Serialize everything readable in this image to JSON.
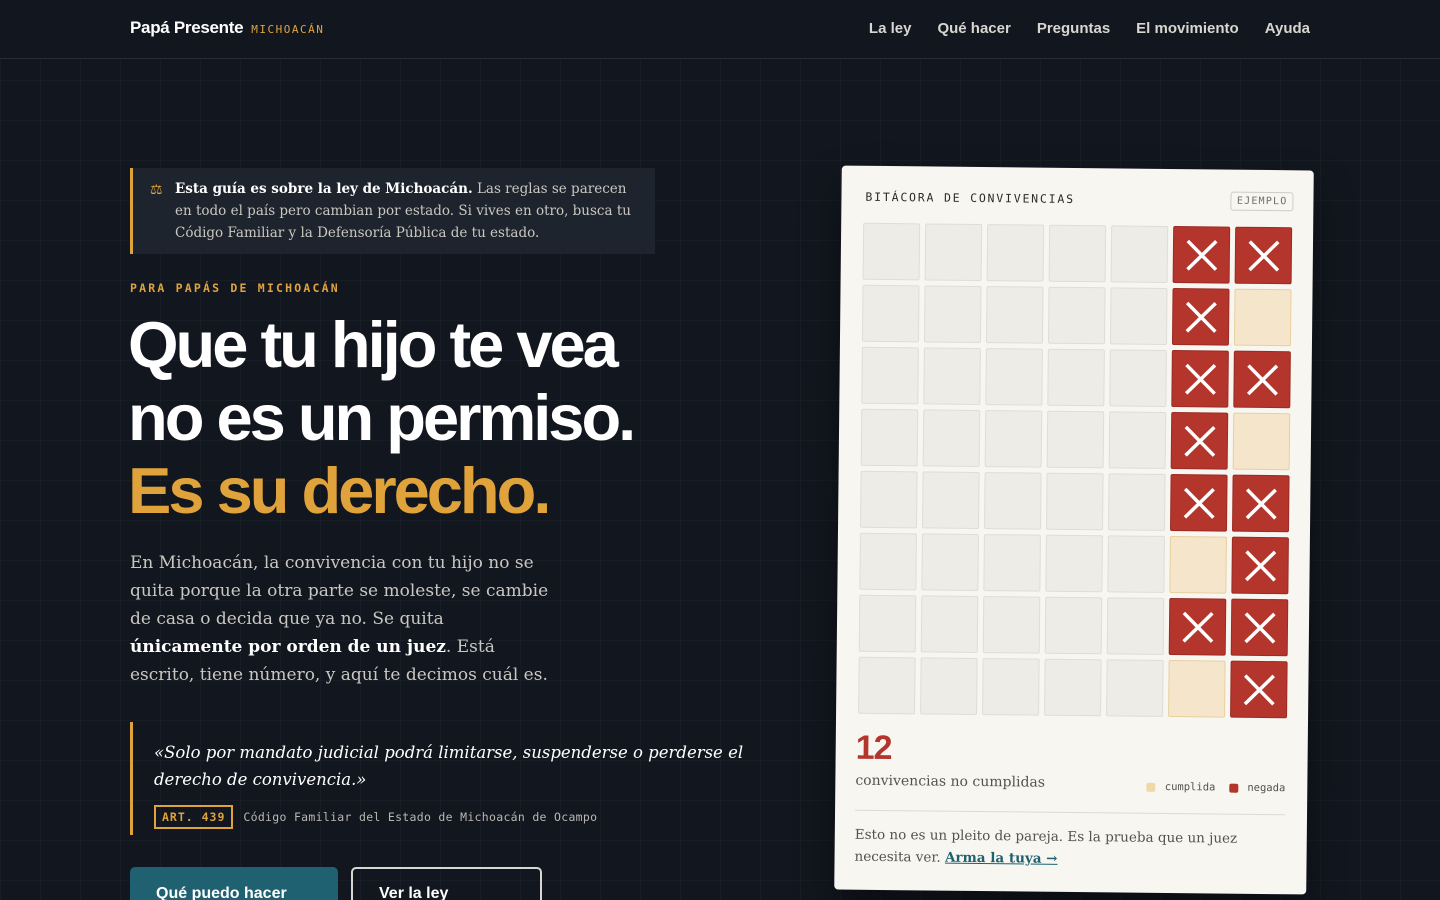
{
  "header": {
    "brand": "Papá Presente",
    "region": "MICHOACÁN",
    "nav": [
      "La ley",
      "Qué hacer",
      "Preguntas",
      "El movimiento",
      "Ayuda"
    ]
  },
  "notice": {
    "icon": "scales-icon",
    "bold": "Esta guía es sobre la ley de Michoacán.",
    "text": " Las reglas se parecen en todo el país pero cambian por estado. Si vives en otro, busca tu Código Familiar y la Defensoría Pública de tu estado."
  },
  "hero": {
    "eyebrow": "PARA PAPÁS DE MICHOACÁN",
    "line1": "Que tu hijo te vea",
    "line2": "no es un permiso.",
    "line3": "Es su derecho.",
    "lede_part1": "En Michoacán, la convivencia con tu hijo no se quita porque la otra parte se moleste, se cambie de casa o decida que ya no. Se quita ",
    "lede_bold": "únicamente por orden de un juez",
    "lede_part2": ". Está escrito, tiene número, y aquí te decimos cuál es."
  },
  "quote": {
    "text": "«Solo por mandato judicial podrá limitarse, suspenderse o perderse el derecho de convivencia.»",
    "article": "ART. 439",
    "source": "Código Familiar del Estado de Michoacán de Ocampo"
  },
  "buttons": {
    "primary": "Qué puedo hacer hoy",
    "secondary": "Ver la ley completa"
  },
  "card": {
    "title": "BITÁCORA DE CONVIVENCIAS",
    "tag": "EJEMPLO",
    "grid": [
      [
        "empty",
        "empty",
        "empty",
        "empty",
        "empty",
        "negada",
        "negada"
      ],
      [
        "empty",
        "empty",
        "empty",
        "empty",
        "empty",
        "negada",
        "cumplida"
      ],
      [
        "empty",
        "empty",
        "empty",
        "empty",
        "empty",
        "negada",
        "negada"
      ],
      [
        "empty",
        "empty",
        "empty",
        "empty",
        "empty",
        "negada",
        "cumplida"
      ],
      [
        "empty",
        "empty",
        "empty",
        "empty",
        "empty",
        "negada",
        "negada"
      ],
      [
        "empty",
        "empty",
        "empty",
        "empty",
        "empty",
        "cumplida",
        "negada"
      ],
      [
        "empty",
        "empty",
        "empty",
        "empty",
        "empty",
        "negada",
        "negada"
      ],
      [
        "empty",
        "empty",
        "empty",
        "empty",
        "empty",
        "cumplida",
        "negada"
      ]
    ],
    "stat_number": "12",
    "stat_label": "convivencias no cumplidas",
    "legend": [
      {
        "label": "cumplida",
        "color": "#f0d9a8"
      },
      {
        "label": "negada",
        "color": "#b3352c"
      }
    ],
    "note": "Esto no es un pleito de pareja. Es la prueba que un juez necesita ver. ",
    "note_link": "Arma la tuya →"
  },
  "colors": {
    "background": "#12171f",
    "accent": "#e0a33c",
    "primary_button": "#1f6171",
    "denied": "#b3352c",
    "fulfilled": "#f5e6cb"
  }
}
